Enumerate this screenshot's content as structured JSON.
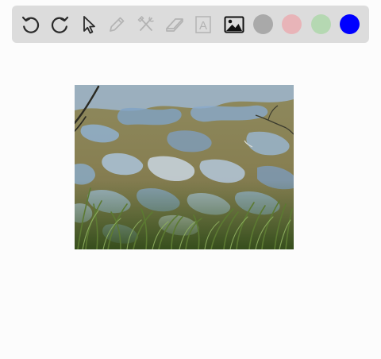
{
  "toolbar": {
    "tools": [
      {
        "name": "undo",
        "icon": "undo-icon",
        "enabled": true
      },
      {
        "name": "redo",
        "icon": "redo-icon",
        "enabled": true
      },
      {
        "name": "select",
        "icon": "cursor-icon",
        "enabled": true
      },
      {
        "name": "pencil",
        "icon": "pencil-icon",
        "enabled": false
      },
      {
        "name": "tools",
        "icon": "hammer-wrench-icon",
        "enabled": false
      },
      {
        "name": "eraser",
        "icon": "eraser-icon",
        "enabled": false
      },
      {
        "name": "text",
        "icon": "text-box-icon",
        "label": "A",
        "enabled": false
      },
      {
        "name": "image",
        "icon": "image-icon",
        "enabled": true
      }
    ],
    "colors": [
      {
        "name": "gray",
        "hex": "#a9a9a9"
      },
      {
        "name": "pink",
        "hex": "#e8b4b8"
      },
      {
        "name": "green",
        "hex": "#b5d8b2"
      },
      {
        "name": "blue",
        "hex": "#0000ff"
      }
    ]
  },
  "canvas": {
    "image": {
      "subject": "pond-with-algae-and-grass-photo"
    }
  }
}
